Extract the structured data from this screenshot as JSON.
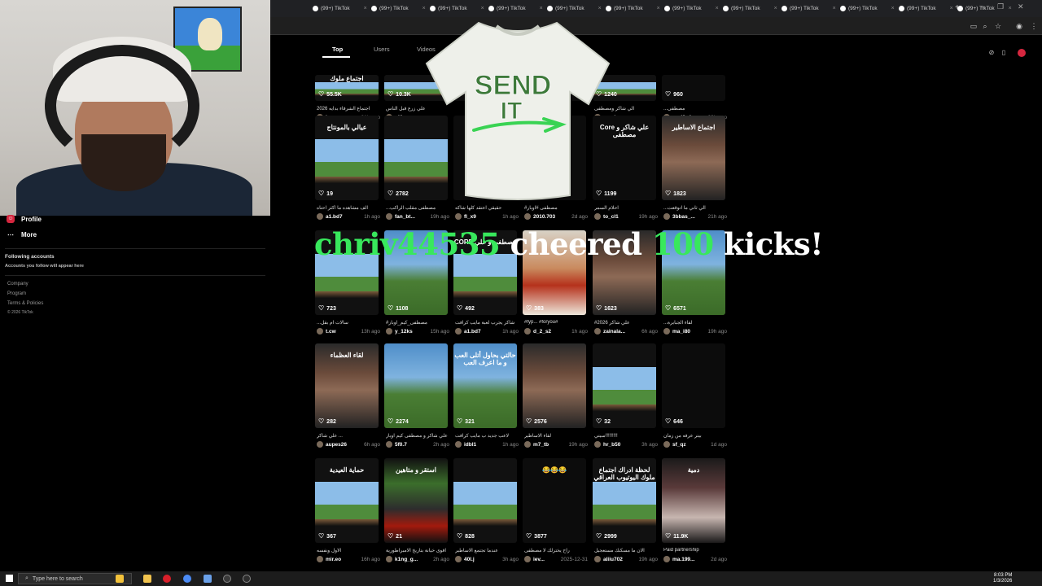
{
  "browser": {
    "tabs": [
      {
        "label": "(99+) TikTok"
      },
      {
        "label": "(99+) TikTok"
      },
      {
        "label": "(99+) TikTok"
      },
      {
        "label": "(99+) TikTok"
      },
      {
        "label": "(99+) TikTok"
      },
      {
        "label": "(99+) TikTok"
      },
      {
        "label": "(99+) TikTok"
      },
      {
        "label": "(99+) TikTok"
      },
      {
        "label": "(99+) TikTok"
      },
      {
        "label": "(99+) TikTok"
      },
      {
        "label": "(99+) TikTok"
      },
      {
        "label": "(99+) TikTok"
      }
    ],
    "new_tab": "+",
    "close_glyph": "×"
  },
  "sidebar": {
    "profile": "Profile",
    "more": "More",
    "following_title": "Following accounts",
    "following_hint": "Accounts you follow will appear here",
    "links": [
      "Company",
      "Program",
      "Terms & Policies",
      "© 2026 TikTok"
    ]
  },
  "search_tabs": {
    "top": "Top",
    "users": "Users",
    "videos": "Videos"
  },
  "overlay": {
    "shirt_line1": "SEND",
    "shirt_line2": "IT",
    "cheer_user": "chriv44535",
    "cheer_mid": "cheered",
    "cheer_amount": "100",
    "cheer_rest": "kicks!"
  },
  "grid": [
    {
      "likes": "55.5K",
      "caption": "اجتماع الشرقاء بدايه 2026",
      "author": "hamzz...",
      "ago": "21h ago",
      "thumb": "mc",
      "overlay": "اجتماع ملوك"
    },
    {
      "likes": "10.3K",
      "caption": "علي زرع قبل الناس",
      "author": "r40es",
      "ago": "",
      "thumb": "mc",
      "overlay": ""
    },
    {
      "likes": "",
      "caption": "",
      "author": "",
      "ago": "",
      "thumb": "dark",
      "overlay": ""
    },
    {
      "likes": "",
      "caption": "",
      "author": "",
      "ago": "",
      "thumb": "dark",
      "overlay": ""
    },
    {
      "likes": "1240",
      "caption": "الي شاكر ومصطفى",
      "author": "znari...",
      "ago": "",
      "thumb": "mc",
      "overlay": ""
    },
    {
      "likes": "960",
      "caption": "...مصطفى",
      "author": "mrd3y4",
      "ago": "20h ago",
      "thumb": "dark",
      "overlay": ""
    },
    {
      "likes": "19",
      "caption": "الف مشاهده ما اكثر احتاه",
      "author": "a1.bd7",
      "ago": "1h ago",
      "thumb": "mc",
      "overlay": "عيالي بالمونتاج"
    },
    {
      "likes": "2782",
      "caption": "...مصطفى مقلب الراكب",
      "author": "fan_bt...",
      "ago": "19h ago",
      "thumb": "mc",
      "overlay": ""
    },
    {
      "likes": "",
      "caption": "حقيقي اعتقد كلها شاكه",
      "author": "fl_x9",
      "ago": "1h ago",
      "thumb": "dark",
      "overlay": ""
    },
    {
      "likes": "",
      "caption": "#مصطفى #اوبار",
      "author": "2010.703",
      "ago": "2d ago",
      "thumb": "dark",
      "overlay": ""
    },
    {
      "likes": "1199",
      "caption": "احلام السمر",
      "author": "to_cl1",
      "ago": "19h ago",
      "thumb": "dark",
      "overlay": "Core علي شاكر و مصطفى"
    },
    {
      "likes": "1823",
      "caption": "...الي ثاني ما اتوقعت",
      "author": "3bbas_...",
      "ago": "21h ago",
      "thumb": "face",
      "overlay": "اجتماع الاساطير"
    },
    {
      "likes": "723",
      "caption": "...سالات ام بقل",
      "author": "t.cw",
      "ago": "13h ago",
      "thumb": "mc",
      "overlay": ""
    },
    {
      "likes": "1108",
      "caption": "#مصطفى_كيم_اوبار",
      "author": "y_12ks",
      "ago": "15h ago",
      "thumb": "tree",
      "overlay": ""
    },
    {
      "likes": "492",
      "caption": "شاكر يجرب لعبة مايب كرافت",
      "author": "a1.bd7",
      "ago": "1h ago",
      "thumb": "mc",
      "overlay": "CORE مصطفى و علي"
    },
    {
      "likes": "383",
      "caption": "#fyp... #foryou#",
      "author": "d_2_s2",
      "ago": "1h ago",
      "thumb": "pizza",
      "overlay": ""
    },
    {
      "likes": "1623",
      "caption": "#2026 علي شاكر",
      "author": "zainala...",
      "ago": "6h ago",
      "thumb": "face",
      "overlay": ""
    },
    {
      "likes": "6571",
      "caption": "...لقاء الجبابرة",
      "author": "ma_i80",
      "ago": "19h ago",
      "thumb": "tree",
      "overlay": ""
    },
    {
      "likes": "282",
      "caption": "علي شاكر ...",
      "author": "aupes26",
      "ago": "6h ago",
      "thumb": "face",
      "overlay": "لقاء العظماء"
    },
    {
      "likes": "2274",
      "caption": "علي شاكر و مصطفى كيم اوبار",
      "author": "5f0.7",
      "ago": "2h ago",
      "thumb": "tree",
      "overlay": ""
    },
    {
      "likes": "321",
      "caption": "لاعب جديد ب مايب كرافت",
      "author": "idbl1",
      "ago": "1h ago",
      "thumb": "tree",
      "overlay": "حالتي بحاول أتلى العب و ما اعرف العب"
    },
    {
      "likes": "2576",
      "caption": "لقاء الاساطير",
      "author": "m7_tb",
      "ago": "19h ago",
      "thumb": "face",
      "overlay": ""
    },
    {
      "likes": "32",
      "caption": "سيتي!!!!!!!!!",
      "author": "hr_b50",
      "ago": "3h ago",
      "thumb": "mc",
      "overlay": ""
    },
    {
      "likes": "646",
      "caption": "بيتر عرفه من زمان",
      "author": "sf_qz",
      "ago": "1d ago",
      "thumb": "dark",
      "overlay": ""
    },
    {
      "likes": "367",
      "caption": "الاول ونفسه",
      "author": "mir.eo",
      "ago": "16h ago",
      "thumb": "mc",
      "overlay": "حماية العيدية"
    },
    {
      "likes": "21",
      "caption": "اقوى خيانة بتاريخ الامبراطورية",
      "author": "k1ng_g...",
      "ago": "2h ago",
      "thumb": "red",
      "overlay": "استقر و متاهين"
    },
    {
      "likes": "828",
      "caption": "عندما تجتمع الاساطير",
      "author": "40l.j",
      "ago": "3h ago",
      "thumb": "mc",
      "overlay": ""
    },
    {
      "likes": "3877",
      "caption": "راح يخترلك لا مصطفى",
      "author": "iev...",
      "ago": "2025-12-31",
      "thumb": "dark",
      "overlay": "😂😂😂"
    },
    {
      "likes": "2999",
      "caption": "الان ما مسكنك مستعجيل",
      "author": "aliiu702",
      "ago": "19h ago",
      "thumb": "mc",
      "overlay": "لحظة ادراك اجتماع ملوك اليوتيوب العراقي"
    },
    {
      "likes": "11.9K",
      "caption": "Paid partnership",
      "author": "ma.199...",
      "ago": "2d ago",
      "thumb": "pink",
      "overlay": "دمية"
    }
  ],
  "taskbar": {
    "search_placeholder": "Type here to search",
    "time": "8:03 PM",
    "date": "1/3/2026"
  }
}
